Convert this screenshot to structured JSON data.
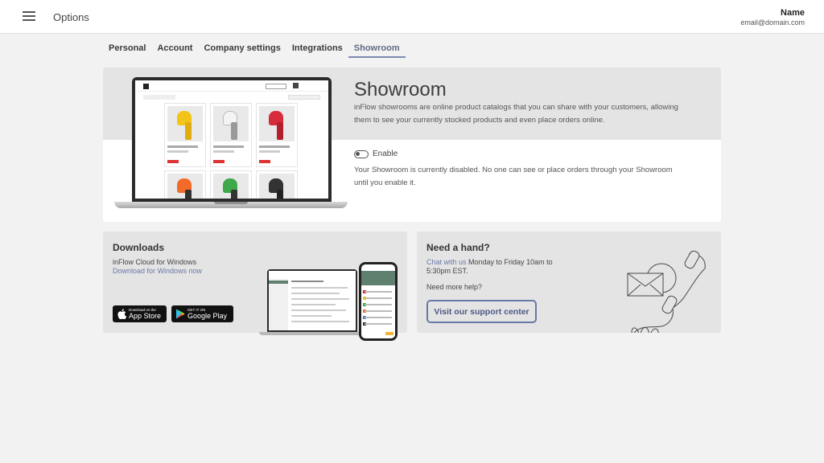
{
  "header": {
    "title": "Options",
    "user_name": "Name",
    "user_email": "email@domain.com"
  },
  "tabs": [
    {
      "label": "Personal",
      "active": false
    },
    {
      "label": "Account",
      "active": false
    },
    {
      "label": "Company settings",
      "active": false
    },
    {
      "label": "Integrations",
      "active": false
    },
    {
      "label": "Showroom",
      "active": true
    }
  ],
  "showroom": {
    "title": "Showroom",
    "description": "inFlow showrooms are online product catalogs that you can share with your customers, allowing them to see your currently stocked products and even place orders online.",
    "toggle_label": "Enable",
    "enabled": false,
    "disabled_message": "Your Showroom is currently disabled. No one can see or place orders through your Showroom until you enable it."
  },
  "downloads": {
    "title": "Downloads",
    "subtitle": "inFlow Cloud for Windows",
    "link": "Download for Windows now",
    "app_store": {
      "small": "Download on the",
      "big": "App Store"
    },
    "google_play": {
      "small": "GET IT ON",
      "big": "Google Play"
    }
  },
  "help": {
    "title": "Need a hand?",
    "chat_link": "Chat with us",
    "hours": " Monday to Friday 10am to 5:30pm EST.",
    "more_help": "Need more help?",
    "support_button": "Visit our support center"
  },
  "colors": {
    "accent": "#6a78a6",
    "card_bg": "#e4e4e4",
    "page_bg": "#f2f2f2"
  }
}
